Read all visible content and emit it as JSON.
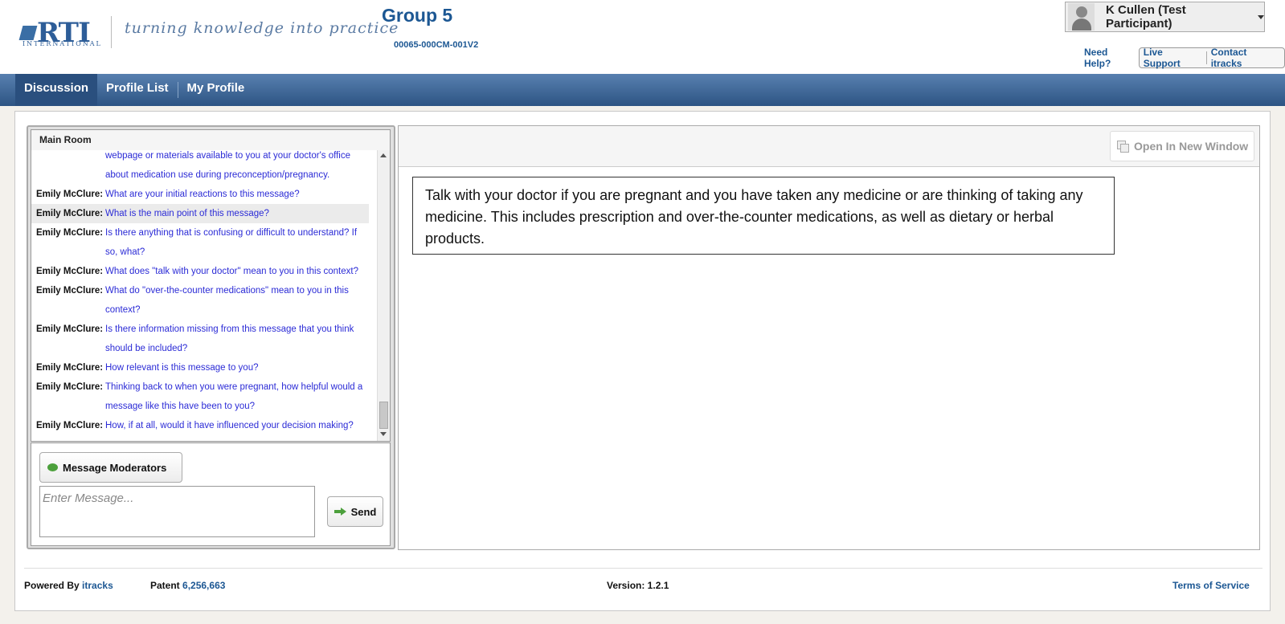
{
  "header": {
    "logo_text": "RTI",
    "logo_subtext": "INTERNATIONAL",
    "tagline": "turning knowledge into practice",
    "group_title": "Group 5",
    "project_code": "00065-000CM-001V2",
    "user_name": "K Cullen (Test Participant)",
    "need_help": "Need Help?",
    "live_support": "Live Support",
    "contact": "Contact itracks"
  },
  "nav": {
    "items": [
      {
        "label": "Discussion",
        "active": true
      },
      {
        "label": "Profile List",
        "active": false
      },
      {
        "label": "My Profile",
        "active": false
      }
    ]
  },
  "chat": {
    "room_title": "Main Room",
    "messages": [
      {
        "author": "",
        "text": "webpage or materials available to you at your doctor's office about medication use during preconception/pregnancy."
      },
      {
        "author": "Emily McClure:",
        "text": "What are your initial reactions to this message?"
      },
      {
        "author": "Emily McClure:",
        "text": "What is the main point of this message?"
      },
      {
        "author": "Emily McClure:",
        "text": "Is there anything that is confusing or difficult to understand? If so, what?"
      },
      {
        "author": "Emily McClure:",
        "text": "What does \"talk with your doctor\" mean to you in this context?"
      },
      {
        "author": "Emily McClure:",
        "text": "What do \"over-the-counter medications\" mean to you in this context?"
      },
      {
        "author": "Emily McClure:",
        "text": "Is there information missing from this message that you think should be included?"
      },
      {
        "author": "Emily McClure:",
        "text": "How relevant is this message to you?"
      },
      {
        "author": "Emily McClure:",
        "text": "Thinking back to when you were pregnant, how helpful would a message like this have been to you?"
      },
      {
        "author": "Emily McClure:",
        "text": "How, if at all, would it have influenced your decision making?"
      }
    ],
    "message_moderators_label": "Message Moderators",
    "input_placeholder": "Enter Message...",
    "send_label": "Send"
  },
  "content": {
    "open_window_label": "Open In New Window",
    "message_text": "Talk with your doctor if you are pregnant and you have taken any medicine or are thinking of taking any medicine. This includes prescription and over-the-counter medications, as well as dietary or herbal products."
  },
  "footer": {
    "powered_by_label": "Powered By",
    "powered_by_link": "itracks",
    "patent_label": "Patent",
    "patent_number": "6,256,663",
    "version": "Version: 1.2.1",
    "terms": "Terms of Service"
  },
  "colors": {
    "brand_blue": "#1c5793",
    "nav_dark": "#2d5483",
    "chat_text": "#2b2bd6",
    "accent_green": "#4ca03c"
  }
}
